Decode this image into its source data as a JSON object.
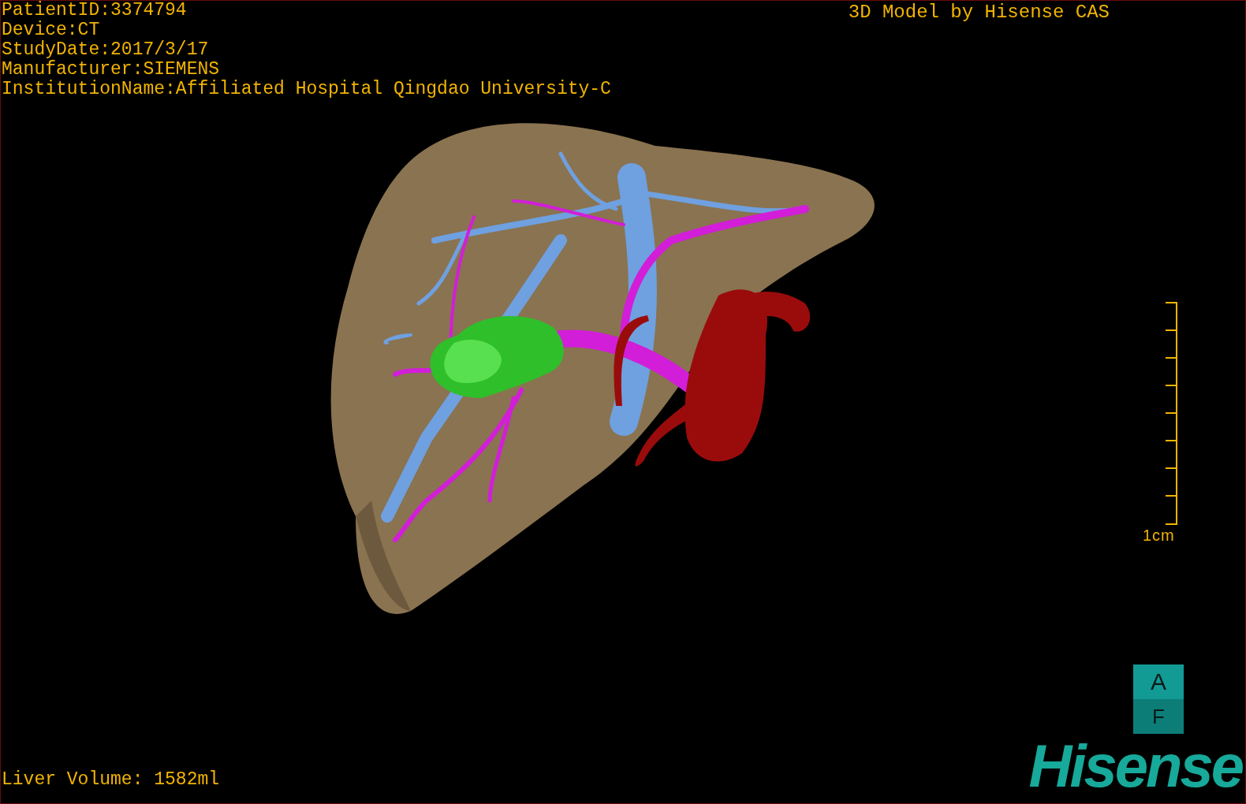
{
  "study_info": [
    "PatientID:3374794",
    "Device:CT",
    "StudyDate:2017/3/17",
    "Manufacturer:SIEMENS",
    "InstitutionName:Affiliated Hospital Qingdao University-C"
  ],
  "viewer_title": "3D Model by Hisense CAS",
  "scale_bar": {
    "label": "1cm"
  },
  "orientation_cube": {
    "top_face": "A",
    "front_face": "F"
  },
  "liver_volume": "Liver Volume: 1582ml",
  "logo": "Hisense"
}
